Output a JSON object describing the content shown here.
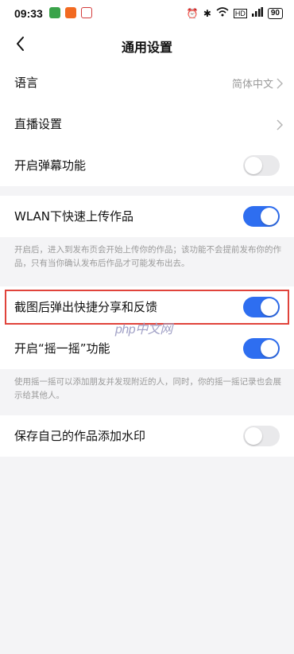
{
  "status_bar": {
    "time": "09:33",
    "battery": "90",
    "app_icon_colors": [
      "#3aa34a",
      "#f26a21",
      "#d33b3b"
    ]
  },
  "nav": {
    "title": "通用设置"
  },
  "rows": {
    "language": {
      "label": "语言",
      "value": "简体中文"
    },
    "live": {
      "label": "直播设置"
    },
    "danmaku": {
      "label": "开启弹幕功能",
      "toggle": "off"
    },
    "wlan": {
      "label": "WLAN下快速上传作品",
      "toggle": "on"
    },
    "screenshot": {
      "label": "截图后弹出快捷分享和反馈",
      "toggle": "on"
    },
    "shake": {
      "label": "开启“摇一摇”功能",
      "toggle": "on"
    },
    "watermark": {
      "label": "保存自己的作品添加水印",
      "toggle": "off"
    }
  },
  "descriptions": {
    "wlan": "开启后，进入到发布页会开始上传你的作品；该功能不会提前发布你的作品，只有当你确认发布后作品才可能发布出去。",
    "shake": "使用摇一摇可以添加朋友并发现附近的人，同时，你的摇一摇记录也会展示给其他人。"
  },
  "watermark_logo": "php中文网",
  "colors": {
    "accent": "#2e6ef0",
    "highlight": "#e0433b"
  }
}
